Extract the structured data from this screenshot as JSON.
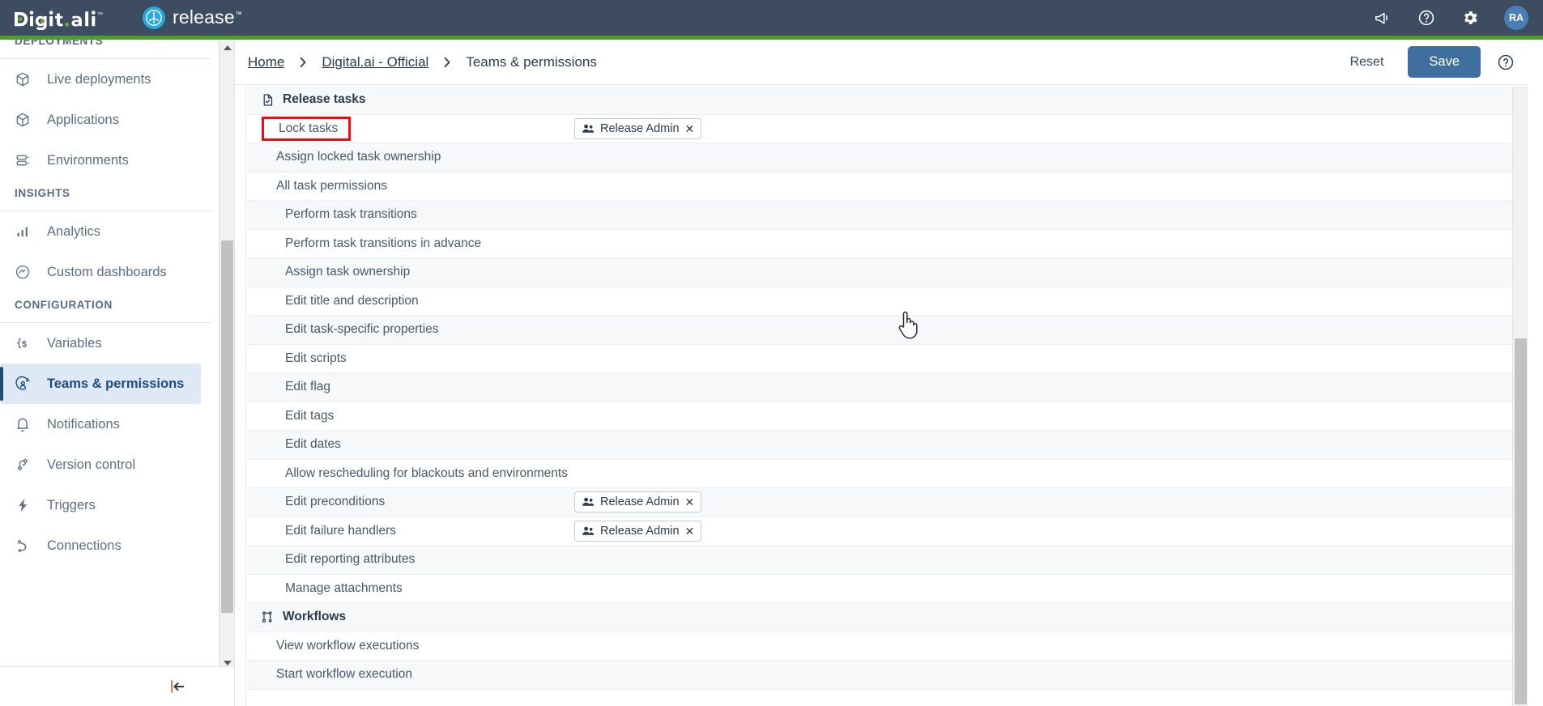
{
  "topbar": {
    "brand_name": "digital.ai",
    "product_name": "release",
    "product_tm": "™",
    "icons": [
      {
        "name": "announcements-icon",
        "label": "Announcements"
      },
      {
        "name": "help-icon",
        "label": "Help"
      },
      {
        "name": "settings-gear-icon",
        "label": "Settings"
      }
    ],
    "avatar_initials": "RA",
    "bg_color": "#3d4c60",
    "accent_green": "#4c9c2e",
    "release_badge_color": "#29a8e0",
    "avatar_color": "#4a7fb5"
  },
  "sidebar": {
    "groups": [
      {
        "label": "DEPLOYMENTS",
        "items": [
          {
            "label": "Live deployments",
            "icon": "package-icon",
            "active": false
          },
          {
            "label": "Applications",
            "icon": "package-icon",
            "active": false
          },
          {
            "label": "Environments",
            "icon": "environments-icon",
            "active": false
          }
        ]
      },
      {
        "label": "INSIGHTS",
        "items": [
          {
            "label": "Analytics",
            "icon": "bar-chart-icon",
            "active": false
          },
          {
            "label": "Custom dashboards",
            "icon": "gauge-icon",
            "active": false
          }
        ]
      },
      {
        "label": "CONFIGURATION",
        "items": [
          {
            "label": "Variables",
            "icon": "variable-icon",
            "active": false
          },
          {
            "label": "Teams & permissions",
            "icon": "team-permissions-icon",
            "active": true
          },
          {
            "label": "Notifications",
            "icon": "bell-icon",
            "active": false
          },
          {
            "label": "Version control",
            "icon": "git-branch-icon",
            "active": false
          },
          {
            "label": "Triggers",
            "icon": "lightning-icon",
            "active": false
          },
          {
            "label": "Connections",
            "icon": "connections-icon",
            "active": false
          }
        ]
      }
    ],
    "collapse_icon": "collapse-sidebar-icon",
    "active_bg": "#dfe8f5",
    "active_text": "#1b4d7e"
  },
  "header": {
    "breadcrumb": [
      {
        "label": "Home",
        "type": "link"
      },
      {
        "label": "Digital.ai - Official",
        "type": "link"
      },
      {
        "label": "Teams & permissions",
        "type": "current"
      }
    ],
    "separator": "›",
    "reset_label": "Reset",
    "save_label": "Save",
    "help_icon": "help-circle-icon",
    "save_bg": "#3f6f9f"
  },
  "permissions": {
    "highlight_color": "#f30b0b",
    "highlighted_row": "Lock tasks",
    "rows": [
      {
        "kind": "group",
        "label": "Release tasks",
        "icon": "task-document-icon"
      },
      {
        "kind": "perm",
        "label": "Lock tasks",
        "indent": 0,
        "chips": [
          "Release Admin"
        ],
        "highlighted": true
      },
      {
        "kind": "perm",
        "label": "Assign locked task ownership",
        "indent": 0,
        "chips": []
      },
      {
        "kind": "perm",
        "label": "All task permissions",
        "indent": 0,
        "chips": []
      },
      {
        "kind": "perm",
        "label": "Perform task transitions",
        "indent": 1,
        "chips": []
      },
      {
        "kind": "perm",
        "label": "Perform task transitions in advance",
        "indent": 1,
        "chips": []
      },
      {
        "kind": "perm",
        "label": "Assign task ownership",
        "indent": 1,
        "chips": []
      },
      {
        "kind": "perm",
        "label": "Edit title and description",
        "indent": 1,
        "chips": []
      },
      {
        "kind": "perm",
        "label": "Edit task-specific properties",
        "indent": 1,
        "chips": []
      },
      {
        "kind": "perm",
        "label": "Edit scripts",
        "indent": 1,
        "chips": []
      },
      {
        "kind": "perm",
        "label": "Edit flag",
        "indent": 1,
        "chips": []
      },
      {
        "kind": "perm",
        "label": "Edit tags",
        "indent": 1,
        "chips": []
      },
      {
        "kind": "perm",
        "label": "Edit dates",
        "indent": 1,
        "chips": []
      },
      {
        "kind": "perm",
        "label": "Allow rescheduling for blackouts and environments",
        "indent": 1,
        "chips": []
      },
      {
        "kind": "perm",
        "label": "Edit preconditions",
        "indent": 1,
        "chips": [
          "Release Admin"
        ]
      },
      {
        "kind": "perm",
        "label": "Edit failure handlers",
        "indent": 1,
        "chips": [
          "Release Admin"
        ]
      },
      {
        "kind": "perm",
        "label": "Edit reporting attributes",
        "indent": 1,
        "chips": []
      },
      {
        "kind": "perm",
        "label": "Manage attachments",
        "indent": 1,
        "chips": []
      },
      {
        "kind": "group",
        "label": "Workflows",
        "icon": "workflow-nodes-icon"
      },
      {
        "kind": "perm",
        "label": "View workflow executions",
        "indent": 0,
        "chips": []
      },
      {
        "kind": "perm",
        "label": "Start workflow execution",
        "indent": 0,
        "chips": []
      }
    ],
    "chip_icon": "users-icon",
    "chip_remove_icon": "close-icon"
  },
  "cursor": {
    "name": "pointing-hand-cursor"
  }
}
